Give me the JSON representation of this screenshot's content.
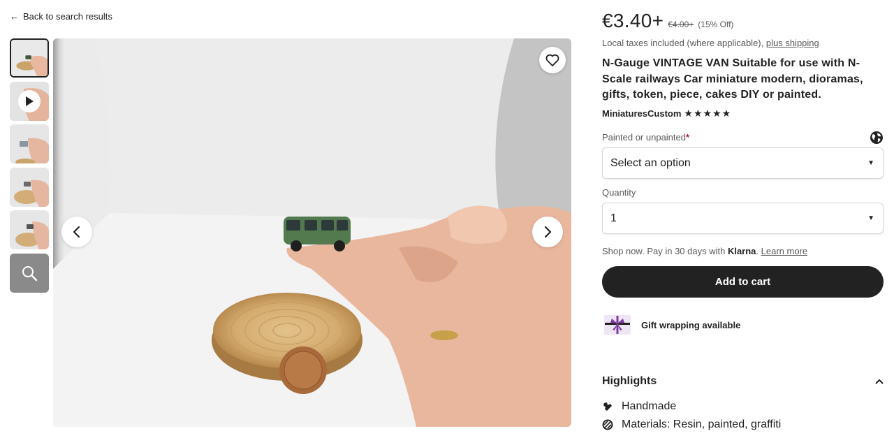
{
  "nav": {
    "back_label": "Back to search results"
  },
  "gallery": {
    "thumbnails": [
      "thumb-1",
      "thumb-2-video",
      "thumb-3",
      "thumb-4",
      "thumb-5",
      "zoom"
    ],
    "favorite_icon": "heart-icon",
    "prev_icon": "chevron-left-icon",
    "next_icon": "chevron-right-icon"
  },
  "listing": {
    "price": "€3.40+",
    "old_price": "€4.00+",
    "discount": "(15% Off)",
    "tax_text": "Local taxes included (where applicable), ",
    "shipping_link": "plus shipping",
    "title": "N-Gauge VINTAGE VAN Suitable for use with N-Scale railways Car miniature modern, dioramas, gifts, token, piece, cakes DIY or painted.",
    "shop_name": "MiniaturesCustom",
    "stars": "★★★★★",
    "rating": 5
  },
  "options": {
    "painted_label": "Painted or unpainted",
    "required_mark": "*",
    "painted_value": "Select an option",
    "quantity_label": "Quantity",
    "quantity_value": "1"
  },
  "payment": {
    "klarna_prefix": "Shop now. Pay in 30 days with ",
    "klarna_brand": "Klarna",
    "klarna_suffix": ". ",
    "learn_more": "Learn more",
    "add_to_cart": "Add to cart"
  },
  "gift": {
    "label": "Gift wrapping available"
  },
  "highlights": {
    "title": "Highlights",
    "items": [
      {
        "icon": "hand-icon",
        "text": "Handmade"
      },
      {
        "icon": "materials-icon",
        "text": "Materials: Resin, painted, graffiti"
      }
    ]
  },
  "colors": {
    "button_bg": "#222222",
    "required": "#a61a2e",
    "gift_purple": "#7b3fa0"
  }
}
